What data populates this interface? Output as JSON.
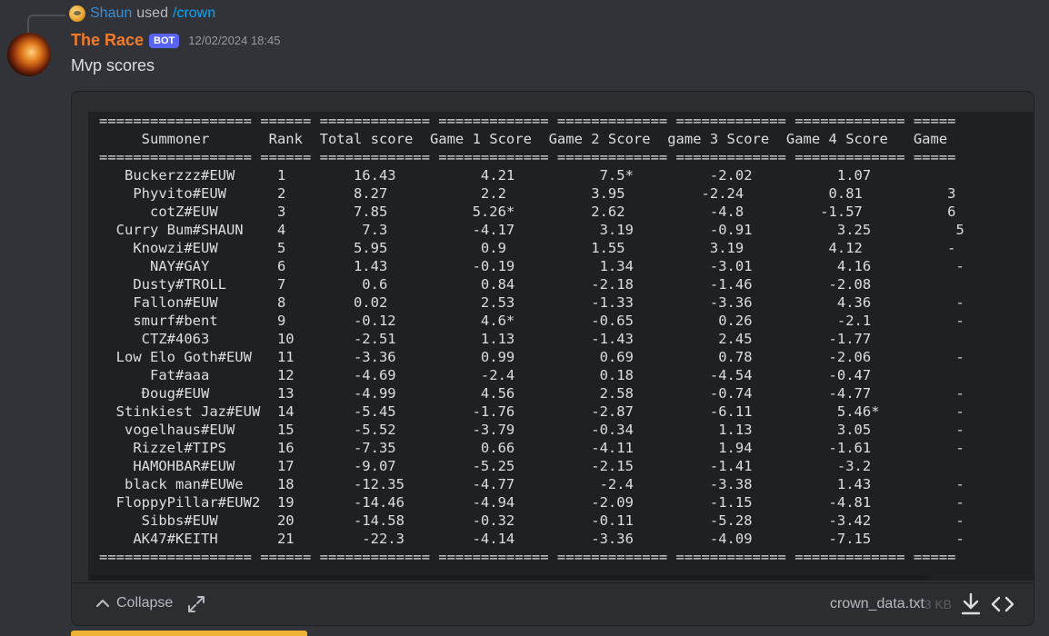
{
  "reply": {
    "user": "Shaun",
    "used": "used",
    "command": "/crown"
  },
  "message": {
    "author": "The Race",
    "badge": "BOT",
    "timestamp": "12/02/2024 18:45",
    "content": "Mvp scores"
  },
  "code_block": {
    "lines": [
      "================== ====== ============= ============= ============= ============= ============= =====",
      "     Summoner       Rank  Total score  Game 1 Score  Game 2 Score  game 3 Score  Game 4 Score   Game",
      "================== ====== ============= ============= ============= ============= ============= =====",
      "   Buckerzzz#EUW     1        16.43          4.21          7.5*         -2.02          1.07",
      "    Phyvito#EUW      2        8.27           2.2          3.95         -2.24          0.81          3",
      "      cotZ#EUW       3        7.85          5.26*         2.62          -4.8         -1.57          6",
      "  Curry Bum#SHAUN    4         7.3          -4.17          3.19         -0.91          3.25          5",
      "    Knowzi#EUW       5        5.95           0.9          1.55          3.19          4.12          -",
      "      NAY#GAY        6        1.43          -0.19          1.34         -3.01          4.16          -",
      "    Dusty#TROLL      7         0.6           0.84         -2.18         -1.46         -2.08",
      "    Fallon#EUW       8        0.02           2.53         -1.33         -3.36          4.36          -",
      "    smurf#bent       9        -0.12          4.6*         -0.65          0.26          -2.1          -",
      "     CTZ#4063        10       -2.51          1.13         -1.43          2.45         -1.77",
      "  Low Elo Goth#EUW   11       -3.36          0.99          0.69          0.78         -2.06          -",
      "      Fat#aaa        12       -4.69          -2.4          0.18         -4.54         -0.47",
      "     Đoug#EUW        13       -4.99          4.56          2.58         -0.74         -4.77          -",
      "  Stinkiest Jaz#EUW  14       -5.45         -1.76         -2.87         -6.11          5.46*         -",
      "   vogelhaus#EUW     15       -5.52         -3.79         -0.34          1.13          3.05          -",
      "    Rizzel#TIPS      16       -7.35          0.66         -4.11          1.94         -1.61          -",
      "    HAMOHBAR#EUW     17       -9.07         -5.25         -2.15         -1.41          -3.2",
      "   black man#EUWe    18       -12.35        -4.77          -2.4         -3.38          1.43          -",
      "  FloppyPillar#EUW2  19       -14.46        -4.94         -2.09         -1.15         -4.81          -",
      "     Sibbs#EUW       20       -14.58        -0.32         -0.11         -5.28         -3.42          -",
      "    AK47#KEITH       21        -22.3        -4.14         -3.36         -4.09         -7.15          -",
      "================== ====== ============= ============= ============= ============= ============= ====="
    ]
  },
  "footer": {
    "collapse_label": "Collapse",
    "file_name": "crown_data.txt",
    "file_size": "3 KB"
  }
}
